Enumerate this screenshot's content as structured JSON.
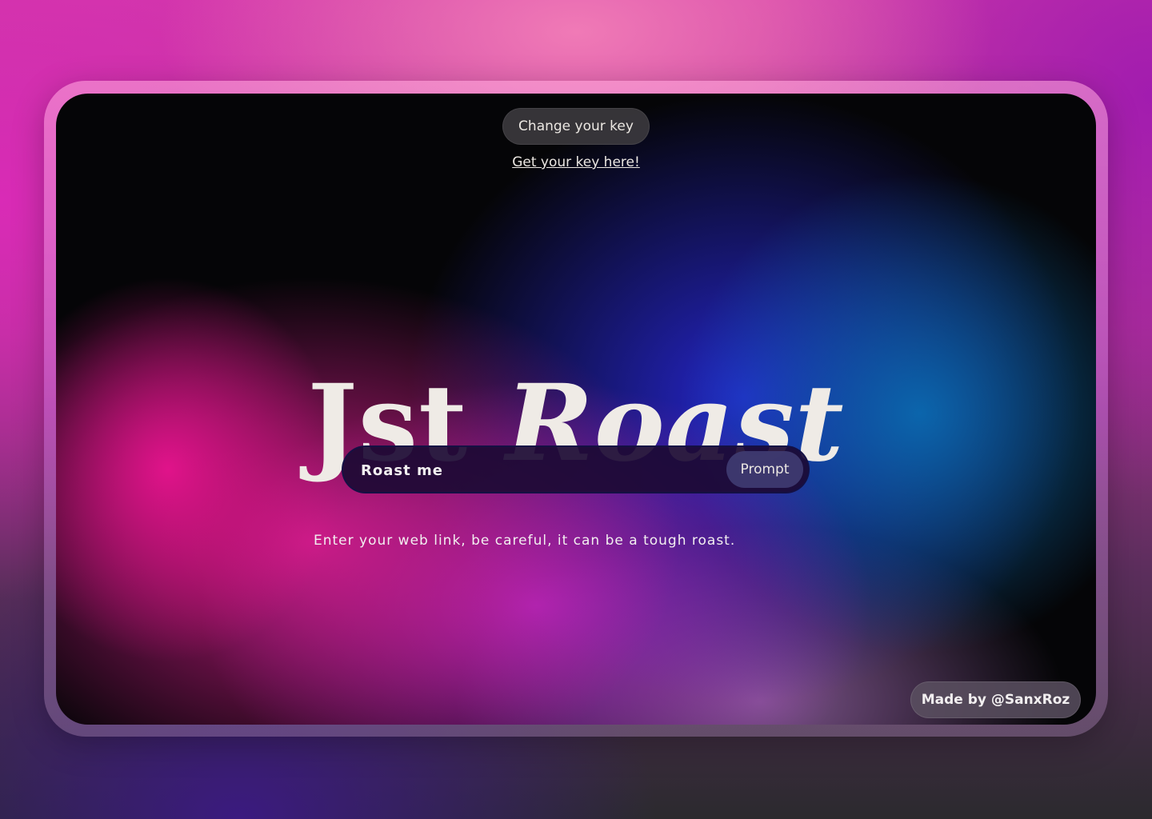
{
  "header": {
    "change_key_label": "Change your key",
    "get_key_link": "Get your key here!"
  },
  "hero": {
    "title_part1": "Jst",
    "title_part2": "Roast"
  },
  "prompt": {
    "input_placeholder": "Roast me",
    "button_label": "Prompt",
    "helper_text": "Enter your web link, be careful, it can be a tough roast."
  },
  "footer": {
    "credit": "Made by @SanxRoz"
  },
  "colors": {
    "text": "#efebe6",
    "card_background": "#050507",
    "accent_pink": "#e0138a",
    "accent_blue": "#2828dc"
  }
}
